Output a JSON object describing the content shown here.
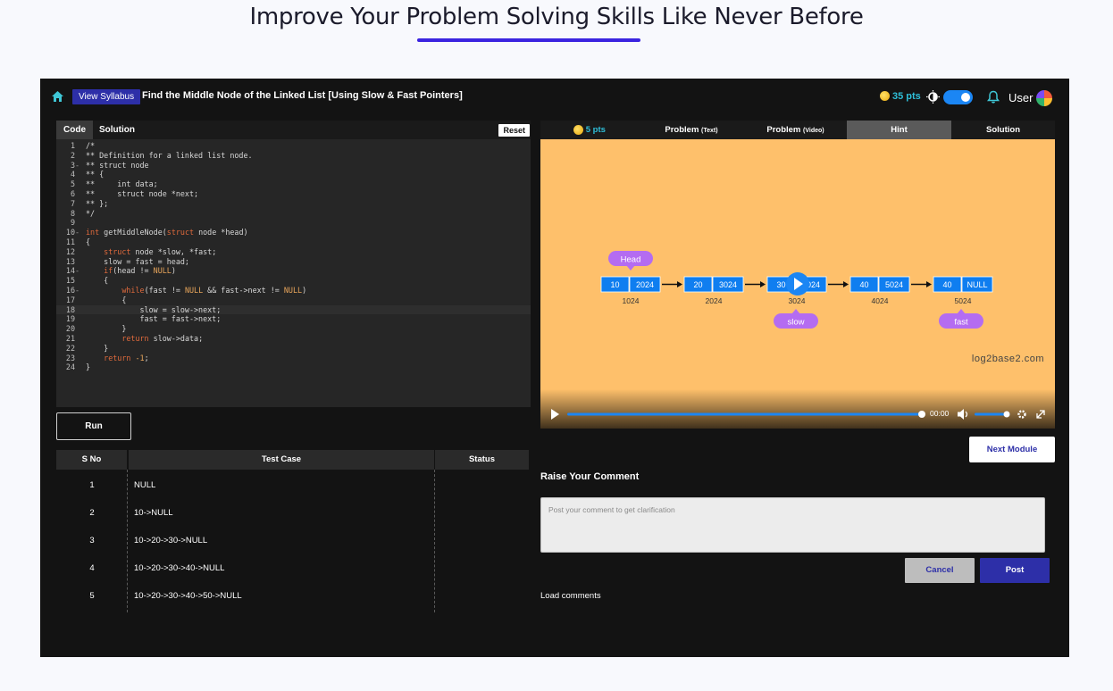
{
  "page": {
    "heading": "Improve Your Problem Solving Skills Like Never Before"
  },
  "topbar": {
    "syllabus_button": "View Syllabus",
    "title": "Find the Middle Node of the Linked List [Using Slow & Fast Pointers]",
    "points": "35 pts",
    "theme_toggle_on": true,
    "user_label": "User"
  },
  "editor": {
    "tabs": [
      "Code",
      "Solution"
    ],
    "reset_label": "Reset",
    "active_line": 18,
    "lines": [
      {
        "n": "1",
        "f": "",
        "t": "/*"
      },
      {
        "n": "2",
        "f": "",
        "t": "** Definition for a linked list node."
      },
      {
        "n": "3",
        "f": "-",
        "t": "** struct node"
      },
      {
        "n": "4",
        "f": "",
        "t": "** {"
      },
      {
        "n": "5",
        "f": "",
        "t": "**     int data;"
      },
      {
        "n": "6",
        "f": "",
        "t": "**     struct node *next;"
      },
      {
        "n": "7",
        "f": "",
        "t": "** };"
      },
      {
        "n": "8",
        "f": "",
        "t": "*/"
      },
      {
        "n": "9",
        "f": "",
        "t": ""
      },
      {
        "n": "10",
        "f": "-",
        "t": "int getMiddleNode(struct node *head)"
      },
      {
        "n": "11",
        "f": "",
        "t": "{"
      },
      {
        "n": "12",
        "f": "",
        "t": "    struct node *slow, *fast;"
      },
      {
        "n": "13",
        "f": "",
        "t": "    slow = fast = head;"
      },
      {
        "n": "14",
        "f": "-",
        "t": "    if(head != NULL)"
      },
      {
        "n": "15",
        "f": "",
        "t": "    {"
      },
      {
        "n": "16",
        "f": "-",
        "t": "        while(fast != NULL && fast->next != NULL)"
      },
      {
        "n": "17",
        "f": "",
        "t": "        {"
      },
      {
        "n": "18",
        "f": "",
        "t": "            slow = slow->next;"
      },
      {
        "n": "19",
        "f": "",
        "t": "            fast = fast->next;"
      },
      {
        "n": "20",
        "f": "",
        "t": "        }"
      },
      {
        "n": "21",
        "f": "",
        "t": "        return slow->data;"
      },
      {
        "n": "22",
        "f": "",
        "t": "    }"
      },
      {
        "n": "23",
        "f": "",
        "t": "    return -1;"
      },
      {
        "n": "24",
        "f": "",
        "t": "}"
      }
    ]
  },
  "run_label": "Run",
  "tests": {
    "headers": [
      "S No",
      "Test Case",
      "Status"
    ],
    "rows": [
      {
        "sno": "1",
        "case": "NULL",
        "status": ""
      },
      {
        "sno": "2",
        "case": "10->NULL",
        "status": ""
      },
      {
        "sno": "3",
        "case": "10->20->30->NULL",
        "status": ""
      },
      {
        "sno": "4",
        "case": "10->20->30->40->NULL",
        "status": ""
      },
      {
        "sno": "5",
        "case": "10->20->30->40->50->NULL",
        "status": ""
      }
    ]
  },
  "right_tabs": {
    "points": "5 pts",
    "problem_text": "Problem",
    "problem_text_sub": "(Text)",
    "problem_video": "Problem",
    "problem_video_sub": "(Video)",
    "hint": "Hint",
    "solution": "Solution"
  },
  "video": {
    "nodes": [
      {
        "data": "10",
        "next": "2024",
        "addr": "1024"
      },
      {
        "data": "20",
        "next": "3024",
        "addr": "2024"
      },
      {
        "data": "30",
        "next": "4024",
        "addr": "3024"
      },
      {
        "data": "40",
        "next": "5024",
        "addr": "4024"
      },
      {
        "data": "40",
        "next": "NULL",
        "addr": "5024"
      }
    ],
    "head_label": "Head",
    "slow_label": "slow",
    "fast_label": "fast",
    "watermark": "log2base2.com",
    "time": "00:00",
    "progress": 1.0,
    "volume": 0.9
  },
  "next_module": "Next Module",
  "comments": {
    "title": "Raise Your Comment",
    "placeholder": "Post your comment to get clarification",
    "cancel": "Cancel",
    "post": "Post",
    "load": "Load comments"
  },
  "colors": {
    "accent": "#2d2fa8",
    "heading_underline": "#3b24e0",
    "video_bg": "#fec06b",
    "node_blue": "#0f7ef0",
    "pointer_purple": "#b46cf1"
  }
}
